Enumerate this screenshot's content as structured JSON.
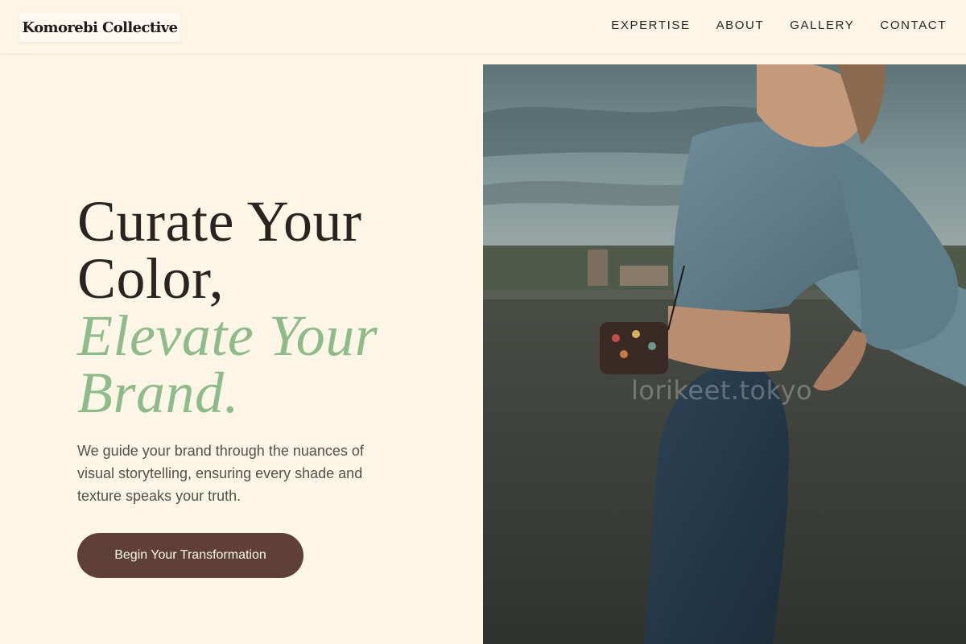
{
  "header": {
    "logo": "Komorebi Collective",
    "nav": [
      "EXPERTISE",
      "ABOUT",
      "GALLERY",
      "CONTACT"
    ]
  },
  "hero": {
    "headline_line1": "Curate Your",
    "headline_line2": "Color,",
    "accent_line1": "Elevate Your",
    "accent_line2": "Brand.",
    "subtext": "We guide your brand through the nuances of visual storytelling, ensuring every shade and texture speaks your truth.",
    "cta_label": "Begin Your Transformation"
  },
  "photo": {
    "watermark": "lorikeet.tokyo"
  },
  "colors": {
    "background": "#fdf5e6",
    "accent_green": "#8fbb8a",
    "button_brown": "#5e4037",
    "text_dark": "#2a2421"
  }
}
